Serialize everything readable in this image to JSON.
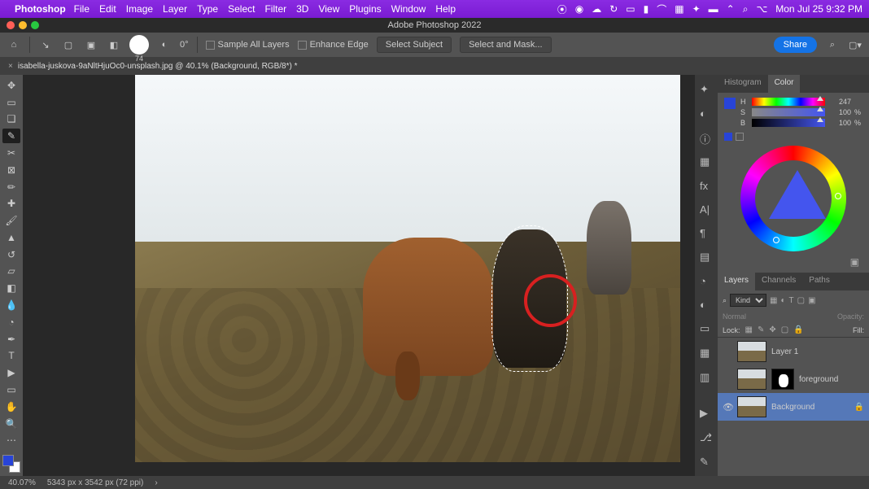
{
  "menubar": {
    "app": "Photoshop",
    "items": [
      "File",
      "Edit",
      "Image",
      "Layer",
      "Type",
      "Select",
      "Filter",
      "3D",
      "View",
      "Plugins",
      "Window",
      "Help"
    ],
    "clock": "Mon Jul 25  9:32 PM"
  },
  "titlebar": {
    "title": "Adobe Photoshop 2022"
  },
  "options": {
    "brush_size": "74",
    "angle_label": "0°",
    "sample_all": "Sample All Layers",
    "enhance_edge": "Enhance Edge",
    "select_subject": "Select Subject",
    "select_and_mask": "Select and Mask...",
    "share": "Share"
  },
  "tab": {
    "filename": "isabella-juskova-9aNltHjuOc0-unsplash.jpg @ 40.1% (Background, RGB/8*) *"
  },
  "color": {
    "tab_histogram": "Histogram",
    "tab_color": "Color",
    "h_label": "H",
    "h_val": "247",
    "s_label": "S",
    "s_val": "100",
    "s_unit": "%",
    "b_label": "B",
    "b_val": "100",
    "b_unit": "%",
    "swatch_hex": "#2844d8"
  },
  "layers": {
    "tab_layers": "Layers",
    "tab_channels": "Channels",
    "tab_paths": "Paths",
    "filter_kind": "Kind",
    "blend_mode": "Normal",
    "opacity_label": "Opacity:",
    "lock_label": "Lock:",
    "fill_label": "Fill:",
    "items": [
      {
        "name": "Layer 1",
        "visible": false
      },
      {
        "name": "foreground",
        "visible": false,
        "has_mask": true
      },
      {
        "name": "Background",
        "visible": true,
        "locked": true
      }
    ]
  },
  "status": {
    "zoom": "40.07%",
    "dims": "5343 px x 3542 px (72 ppi)"
  }
}
